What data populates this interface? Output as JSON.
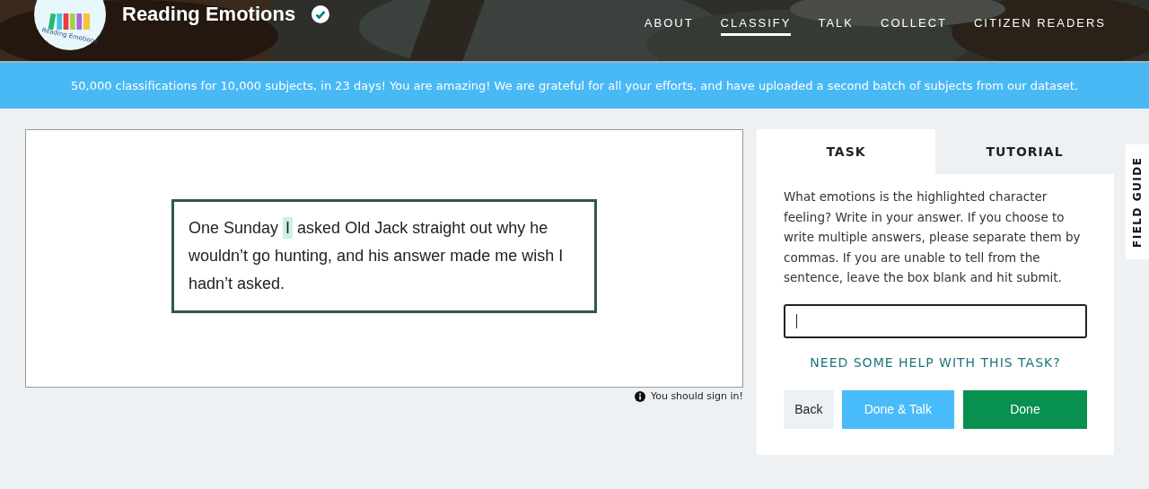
{
  "header": {
    "title": "Reading Emotions",
    "logo_text": "Reading Emotions",
    "verified": true,
    "nav": [
      {
        "label": "ABOUT",
        "selected": false
      },
      {
        "label": "CLASSIFY",
        "selected": true
      },
      {
        "label": "TALK",
        "selected": false
      },
      {
        "label": "COLLECT",
        "selected": false
      },
      {
        "label": "CITIZEN READERS",
        "selected": false
      }
    ]
  },
  "banner": "50,000 classifications for 10,000 subjects, in 23 days! You are amazing! We are grateful for all your efforts, and have uploaded a second batch of subjects from our dataset.",
  "subject": {
    "before": "One Sunday",
    "highlight": "I",
    "after": "asked Old Jack straight out why he wouldn’t go hunting, and his answer made me wish I hadn’t asked."
  },
  "sign_in_note": "You should sign in!",
  "task_panel": {
    "tabs": [
      {
        "label": "TASK",
        "selected": true
      },
      {
        "label": "TUTORIAL",
        "selected": false
      }
    ],
    "question": "What emotions is the highlighted character feeling? Write in your answer. If you choose to write multiple answers, please separate them by commas. If you are unable to tell from the sentence, leave the box blank and hit submit.",
    "help_link": "NEED SOME HELP WITH THIS TASK?",
    "buttons": [
      {
        "label": "Back",
        "kind": "plain"
      },
      {
        "label": "Done & Talk",
        "kind": "talk"
      },
      {
        "label": "Done",
        "kind": "done"
      }
    ]
  },
  "field_guide": "FIELD GUIDE"
}
